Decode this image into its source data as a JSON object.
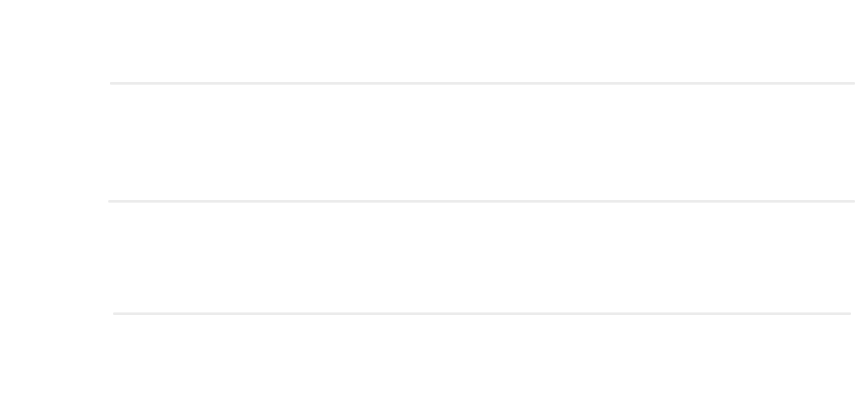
{
  "page": {
    "background": "#ffffff",
    "divider_color": "#ebebeb",
    "sections": [
      {
        "name": "section-1"
      },
      {
        "name": "section-2"
      }
    ]
  }
}
